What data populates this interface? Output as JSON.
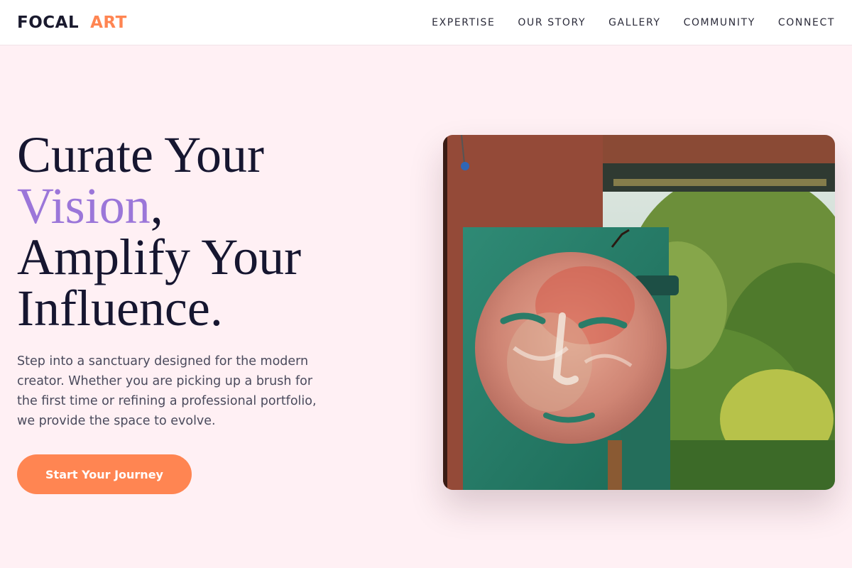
{
  "brand": {
    "word1": "FOCAL",
    "word2": "ART"
  },
  "nav": {
    "items": [
      {
        "label": "EXPERTISE"
      },
      {
        "label": "OUR STORY"
      },
      {
        "label": "GALLERY"
      },
      {
        "label": "COMMUNITY"
      },
      {
        "label": "CONNECT"
      }
    ]
  },
  "hero": {
    "title_part1": "Curate Your",
    "title_accent": "Vision",
    "title_comma": ",",
    "title_part2": "Amplify Your",
    "title_part3": "Influence.",
    "subtitle": "Step into a sanctuary designed for the modern creator. Whether you are picking up a brush for the first time or refining a professional portfolio, we provide the space to evolve.",
    "cta_label": "Start Your Journey",
    "image_subject": "painted-face-on-mural-panel"
  },
  "colors": {
    "background": "#fff0f4",
    "accent_purple": "#9b76d9",
    "accent_orange": "#ff8552",
    "text_dark": "#161630"
  }
}
